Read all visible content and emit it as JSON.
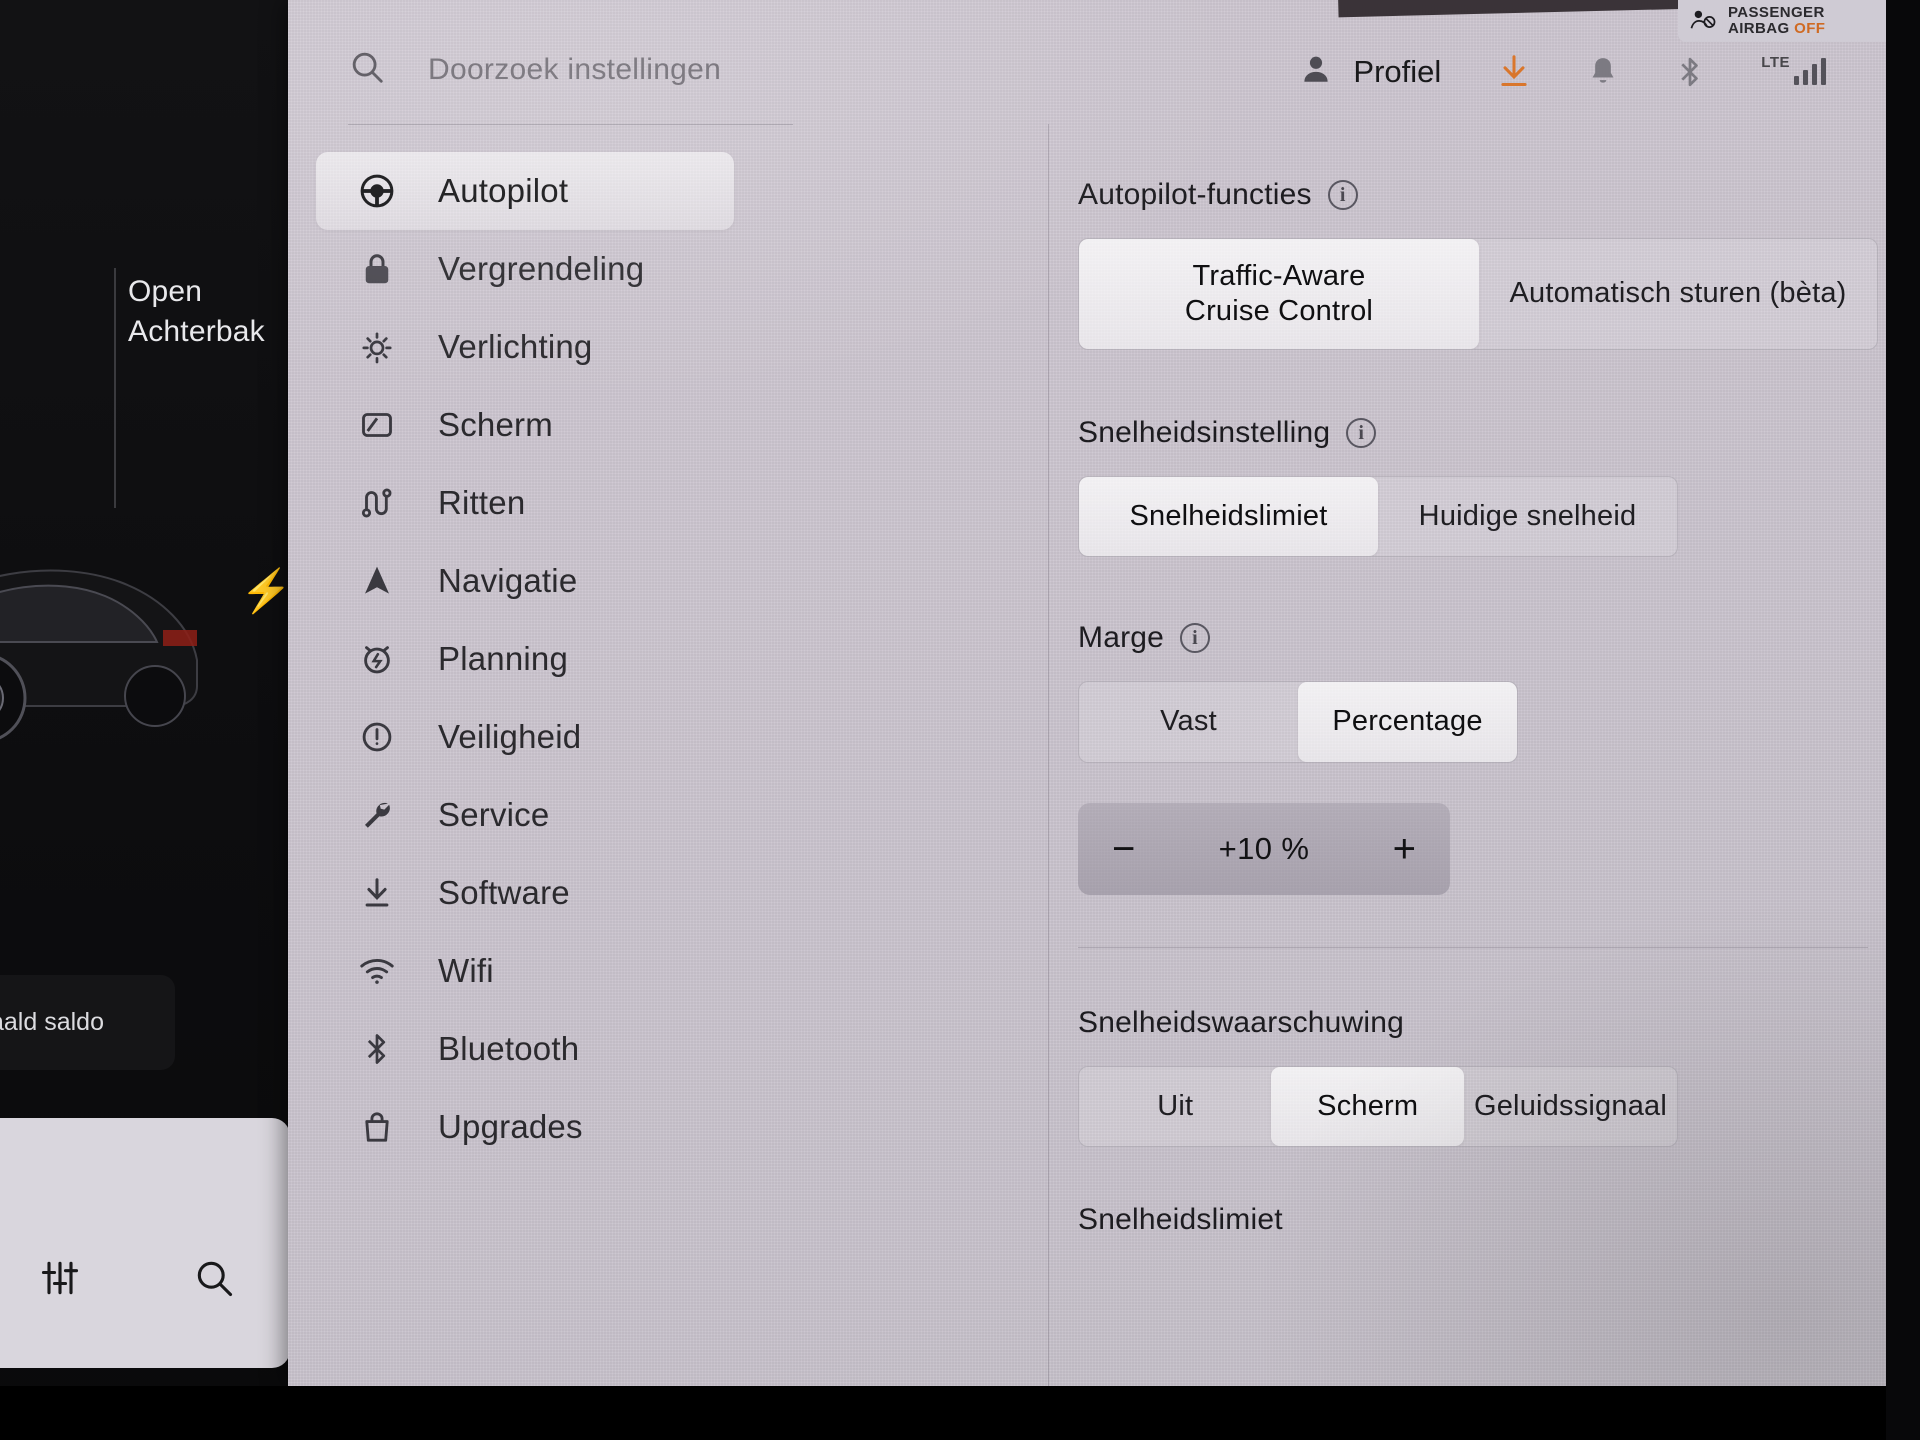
{
  "home": {
    "trunk_line1": "Open",
    "trunk_line2": "Achterbak",
    "balance_label": "aald saldo",
    "bolt_icon": "lightning-bolt-icon",
    "toolbar": [
      {
        "icon": "sliders-icon",
        "name": "controls-icon"
      },
      {
        "icon": "search-icon",
        "name": "search-icon"
      }
    ]
  },
  "airbag": {
    "line1": "PASSENGER",
    "line2": "AIRBAG",
    "status": "OFF",
    "status_color": "#cf6a23",
    "icon": "passenger-airbag-off-icon"
  },
  "header": {
    "search_placeholder": "Doorzoek instellingen",
    "search_icon": "search-icon",
    "profile_label": "Profiel",
    "profile_icon": "person-icon",
    "status_icons": [
      {
        "name": "software-download-icon",
        "color": "#d9762c"
      },
      {
        "name": "bell-icon",
        "color": "#7c7a82"
      },
      {
        "name": "bluetooth-icon",
        "color": "#7c7a82"
      }
    ],
    "network": {
      "label": "LTE",
      "signal_bars": 4
    }
  },
  "sidebar": {
    "selected": "Autopilot",
    "items": [
      {
        "label": "Autopilot",
        "icon": "steering-wheel-icon",
        "selected": true
      },
      {
        "label": "Vergrendeling",
        "icon": "lock-icon",
        "selected": false
      },
      {
        "label": "Verlichting",
        "icon": "brightness-icon",
        "selected": false
      },
      {
        "label": "Scherm",
        "icon": "display-icon",
        "selected": false
      },
      {
        "label": "Ritten",
        "icon": "route-icon",
        "selected": false
      },
      {
        "label": "Navigatie",
        "icon": "navigation-arrow-icon",
        "selected": false
      },
      {
        "label": "Planning",
        "icon": "alarm-clock-icon",
        "selected": false
      },
      {
        "label": "Veiligheid",
        "icon": "alert-circle-icon",
        "selected": false
      },
      {
        "label": "Service",
        "icon": "wrench-icon",
        "selected": false
      },
      {
        "label": "Software",
        "icon": "download-icon",
        "selected": false
      },
      {
        "label": "Wifi",
        "icon": "wifi-icon",
        "selected": false
      },
      {
        "label": "Bluetooth",
        "icon": "bluetooth-icon",
        "selected": false
      },
      {
        "label": "Upgrades",
        "icon": "shopping-bag-icon",
        "selected": false
      }
    ]
  },
  "content": {
    "sections": [
      {
        "title": "Autopilot-functies",
        "has_info": true,
        "options": [
          {
            "label": "Traffic-Aware\nCruise Control",
            "active": true
          },
          {
            "label": "Automatisch sturen (bèta)",
            "active": false
          }
        ]
      },
      {
        "title": "Snelheidsinstelling",
        "has_info": true,
        "options": [
          {
            "label": "Snelheidslimiet",
            "active": true
          },
          {
            "label": "Huidige snelheid",
            "active": false
          }
        ]
      },
      {
        "title": "Marge",
        "has_info": true,
        "options": [
          {
            "label": "Vast",
            "active": false
          },
          {
            "label": "Percentage",
            "active": true
          }
        ]
      },
      {
        "title": "Snelheidswaarschuwing",
        "has_info": false,
        "options": [
          {
            "label": "Uit",
            "active": false
          },
          {
            "label": "Scherm",
            "active": true
          },
          {
            "label": "Geluidssignaal",
            "active": false
          }
        ]
      }
    ],
    "stepper": {
      "value": "+10 %",
      "decrement_label": "−",
      "increment_label": "+"
    },
    "bottom_section_title": "Snelheidslimiet"
  },
  "text": {
    "autopilot_functies": "Autopilot-functies",
    "tacc": "Traffic-Aware",
    "tacc2": "Cruise Control",
    "autosteer": "Automatisch sturen (bèta)",
    "snelheidsinstelling": "Snelheidsinstelling",
    "snelheidslimiet": "Snelheidslimiet",
    "huidige_snelheid": "Huidige snelheid",
    "marge": "Marge",
    "vast": "Vast",
    "percentage": "Percentage",
    "step_value": "+10 %",
    "minus": "−",
    "plus": "+",
    "snelheidswaarschuwing": "Snelheidswaarschuwing",
    "uit": "Uit",
    "scherm": "Scherm",
    "geluidssignaal": "Geluidssignaal",
    "snelheidslimiet_bottom": "Snelheidslimiet",
    "info_glyph": "i"
  },
  "colors": {
    "panel_bg": "#cbc5cf",
    "accent_orange": "#d9762c",
    "text_primary": "#19191b",
    "text_muted": "#6e6a72"
  }
}
